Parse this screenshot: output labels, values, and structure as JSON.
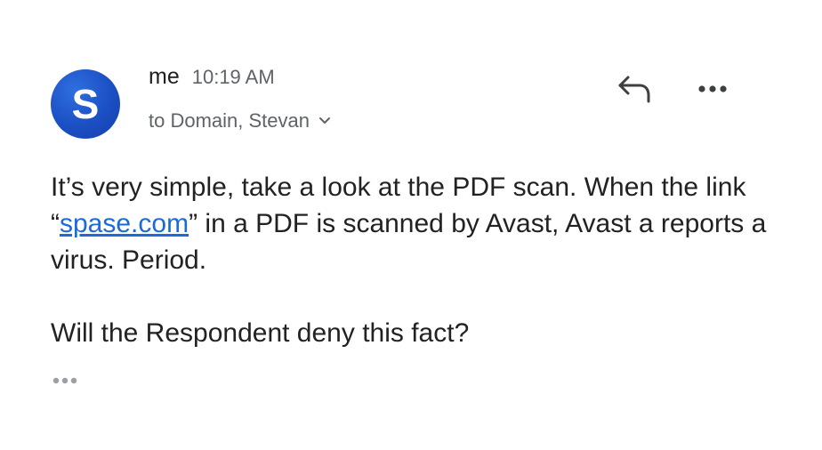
{
  "message": {
    "avatar_letter": "S",
    "avatar_color": "#1b4fc4",
    "sender": "me",
    "time": "10:19 AM",
    "recipients": "to Domain, Stevan",
    "body": {
      "paragraph1_before_link": "It’s very simple, take a look at the PDF scan. When the link “",
      "link_text": "spase.com",
      "paragraph1_after_link": "” in a PDF is scanned by Avast, Avast a reports a virus. Period.",
      "paragraph2": "Will the Respondent deny this fact?"
    }
  },
  "actions": {
    "reply_icon": "reply-arrow-icon",
    "more_icon": "more-horizontal-icon",
    "expand_icon": "chevron-down-icon",
    "trimmed_icon": "ellipsis-icon"
  },
  "colors": {
    "link": "#1a6bd8",
    "secondary_text": "#5f6368"
  }
}
